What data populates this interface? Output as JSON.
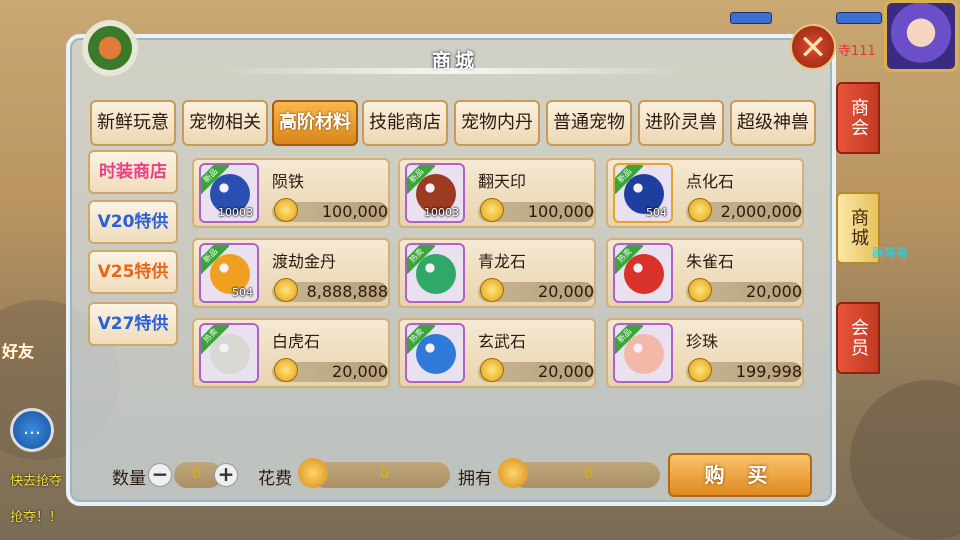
{
  "window": {
    "title": "商城"
  },
  "top_tabs": [
    {
      "label": "新鲜玩意",
      "active": false
    },
    {
      "label": "宠物相关",
      "active": false
    },
    {
      "label": "高阶材料",
      "active": true
    },
    {
      "label": "技能商店",
      "active": false
    },
    {
      "label": "宠物内丹",
      "active": false
    },
    {
      "label": "普通宠物",
      "active": false
    },
    {
      "label": "进阶灵兽",
      "active": false
    },
    {
      "label": "超级神兽",
      "active": false
    }
  ],
  "left_tabs": [
    {
      "label": "时装商店",
      "color": "#e8408a"
    },
    {
      "label": "V20特供",
      "color": "#2b5fd8"
    },
    {
      "label": "V25特供",
      "color": "#e8661a"
    },
    {
      "label": "V27特供",
      "color": "#2b5fd8"
    }
  ],
  "items": [
    {
      "name": "陨铁",
      "price": "100,000",
      "qty": "10003",
      "badge": "新品",
      "badge_color": "#3ba43b",
      "gem_color": "#2a4fb0",
      "frame": "purple"
    },
    {
      "name": "翻天印",
      "price": "100,000",
      "qty": "10003",
      "badge": "新品",
      "badge_color": "#3ba43b",
      "gem_color": "#9c3a22",
      "frame": "purple"
    },
    {
      "name": "点化石",
      "price": "2,000,000",
      "qty": "504",
      "badge": "新品",
      "badge_color": "#3ba43b",
      "gem_color": "#1f3fa0",
      "frame": "gold"
    },
    {
      "name": "渡劫金丹",
      "price": "8,888,888",
      "qty": "504",
      "badge": "新品",
      "badge_color": "#3ba43b",
      "gem_color": "#f0a020",
      "frame": "purple"
    },
    {
      "name": "青龙石",
      "price": "20,000",
      "qty": "",
      "badge": "热卖",
      "badge_color": "#3ba43b",
      "gem_color": "#2fa86a",
      "frame": "purple"
    },
    {
      "name": "朱雀石",
      "price": "20,000",
      "qty": "",
      "badge": "热卖",
      "badge_color": "#3ba43b",
      "gem_color": "#d8322a",
      "frame": "purple"
    },
    {
      "name": "白虎石",
      "price": "20,000",
      "qty": "",
      "badge": "热卖",
      "badge_color": "#3ba43b",
      "gem_color": "#d8d8d2",
      "frame": "purple"
    },
    {
      "name": "玄武石",
      "price": "20,000",
      "qty": "",
      "badge": "热卖",
      "badge_color": "#3ba43b",
      "gem_color": "#2f7ad8",
      "frame": "purple"
    },
    {
      "name": "珍珠",
      "price": "199,998",
      "qty": "",
      "badge": "新品",
      "badge_color": "#3ba43b",
      "gem_color": "#f3b9a8",
      "frame": "purple"
    }
  ],
  "bottom": {
    "qty_label": "数量",
    "qty_value": "0",
    "cost_label": "花费",
    "cost_value": "0",
    "own_label": "拥有",
    "own_value": "0",
    "buy_label": "购 买"
  },
  "side_tabs": [
    {
      "label": "商会",
      "style": "red"
    },
    {
      "label": "商城",
      "style": "gold"
    },
    {
      "label": "会员",
      "style": "red"
    }
  ],
  "hud": {
    "level_text": "寺111",
    "side_text": "器等等"
  },
  "chat": {
    "friend_label": "好友",
    "messages": [
      "快去抢夺",
      "抢夺！！"
    ]
  },
  "icons": {
    "close": "close-icon",
    "emblem": "shop-emblem-icon",
    "coin": "coin-icon"
  }
}
